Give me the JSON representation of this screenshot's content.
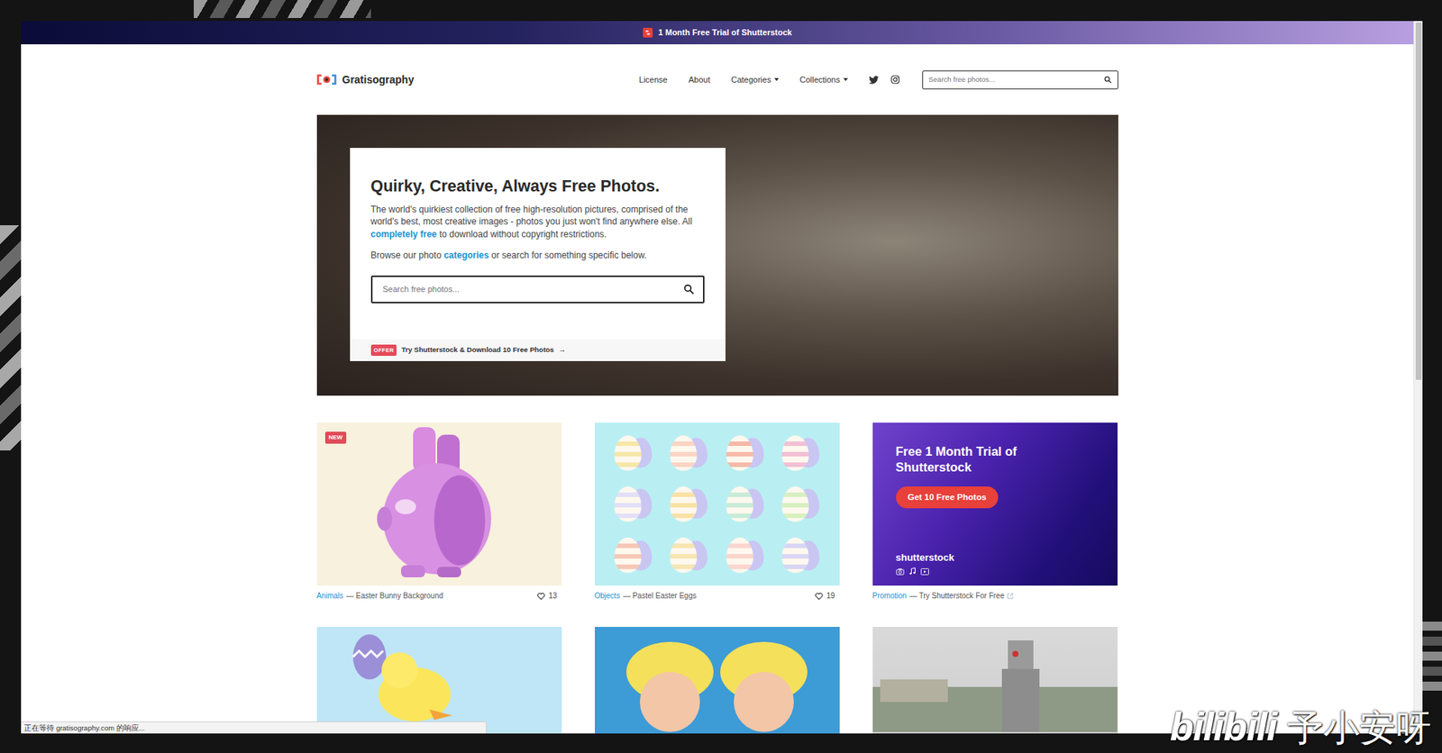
{
  "banner": {
    "text": "1 Month Free Trial of Shutterstock"
  },
  "header": {
    "logo": "Gratisography",
    "nav": [
      {
        "label": "License",
        "dropdown": false
      },
      {
        "label": "About",
        "dropdown": false
      },
      {
        "label": "Categories",
        "dropdown": true
      },
      {
        "label": "Collections",
        "dropdown": true
      }
    ],
    "search": {
      "placeholder": "Search free photos..."
    }
  },
  "hero": {
    "title": "Quirky, Creative, Always Free Photos.",
    "intro_before": "The world's quirkiest collection of free high-resolution pictures, comprised of the world's best, most creative images - photos you just won't find anywhere else. All",
    "intro_link": "completely free",
    "intro_after": "to download without copyright restrictions.",
    "browse_before": "Browse our photo",
    "browse_link": "categories",
    "browse_after": "or search for something specific below.",
    "search": {
      "placeholder": "Search free photos..."
    },
    "offer": {
      "badge": "OFFER",
      "text": "Try Shutterstock & Download 10 Free Photos",
      "arrow": "→"
    }
  },
  "cards": [
    {
      "kind": "photo",
      "badge": "NEW",
      "category": "Animals",
      "title": "— Easter Bunny Background",
      "likes": "13"
    },
    {
      "kind": "photo",
      "category": "Objects",
      "title": "— Pastel Easter Eggs",
      "likes": "19"
    },
    {
      "kind": "promo",
      "heading": "Free 1 Month Trial of Shutterstock",
      "button": "Get 10 Free Photos",
      "brand": "shutterstock",
      "category": "Promotion",
      "title": "— Try Shutterstock For Free"
    },
    {
      "kind": "photo"
    },
    {
      "kind": "photo"
    },
    {
      "kind": "photo"
    }
  ],
  "browser": {
    "status": "正在等待 gratisography.com 的响应..."
  },
  "watermark": {
    "brand": "bilibili",
    "author": "予小安呀"
  }
}
